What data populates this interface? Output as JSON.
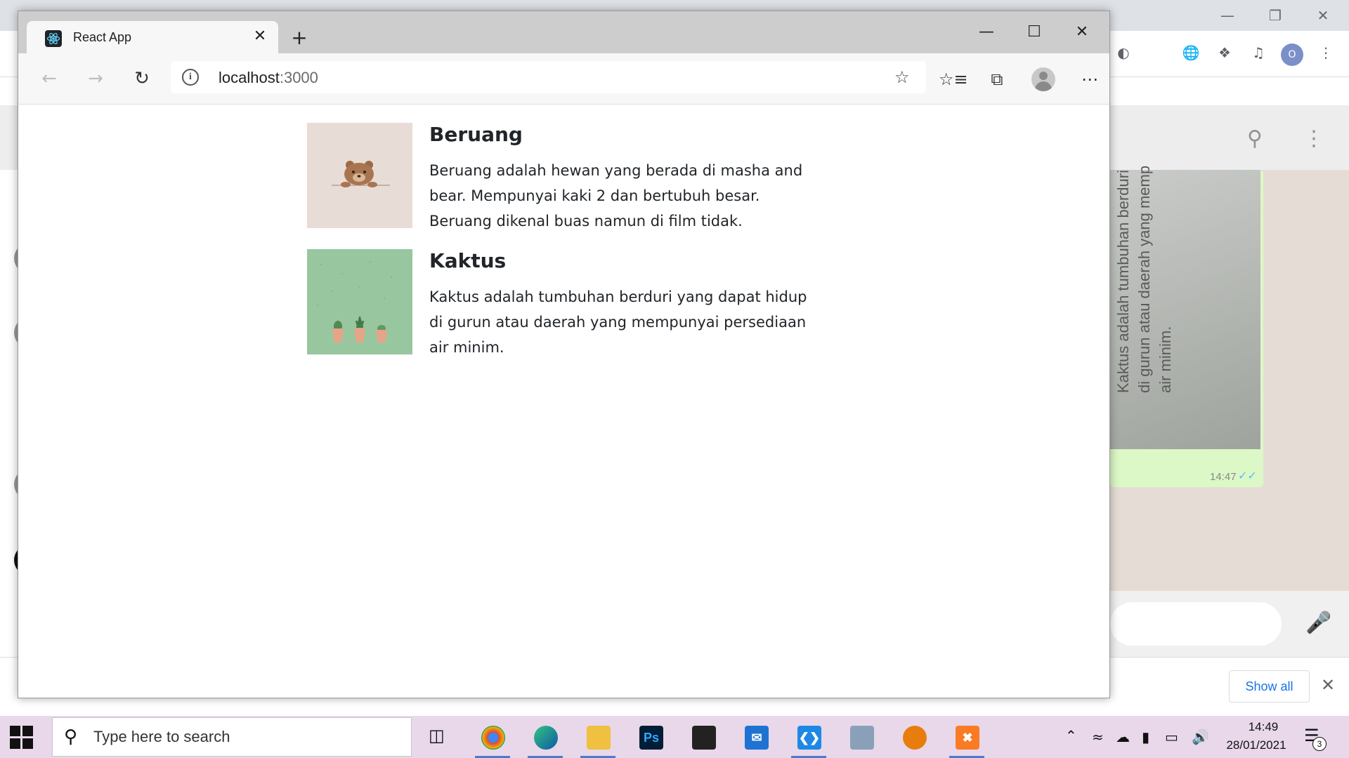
{
  "edge": {
    "tab_title": "React App",
    "url_host": "localhost",
    "url_port": ":3000"
  },
  "cards": [
    {
      "title": "Beruang",
      "text": "Beruang adalah hewan yang berada di masha and bear. Mempunyai kaki 2 dan bertubuh besar. Beruang dikenal buas namun di film tidak.",
      "image": "bear-illustration"
    },
    {
      "title": "Kaktus",
      "text": "Kaktus adalah tumbuhan berduri yang dapat hidup di gurun atau daerah yang mempunyai persediaan air minim.",
      "image": "cactus-illustration"
    }
  ],
  "background_window": {
    "rotated_message": "Kaktus adalah tumbuhan berduri di gurun atau daerah yang memp air minim.",
    "message_time": "14:47",
    "show_all_label": "Show all",
    "avatar_initial": "O"
  },
  "taskbar": {
    "search_placeholder": "Type here to search",
    "time": "14:49",
    "date": "28/01/2021",
    "notification_count": "3",
    "apps": [
      "chrome",
      "edge",
      "file-explorer",
      "photoshop",
      "store",
      "mail",
      "vscode",
      "network-tool",
      "blender",
      "xampp"
    ]
  },
  "colors": {
    "card_beruang_bg": "#e8ddd6",
    "card_kaktus_bg": "#98c69f",
    "taskbar_bg": "#e8d8ea",
    "link_blue": "#1a73e8"
  }
}
